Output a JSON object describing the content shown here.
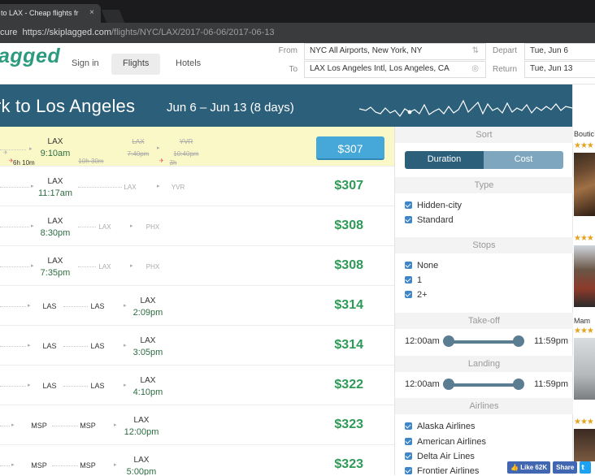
{
  "browser": {
    "tab_title": "to LAX - Cheap flights fr",
    "tab_close": "×",
    "url_prefix": "cure",
    "url_host": "https://skiplagged.com",
    "url_path": "/flights/NYC/LAX/2017-06-06/2017-06-13"
  },
  "header": {
    "logo": "agged",
    "nav": [
      "Sign in",
      "Flights",
      "Hotels"
    ],
    "from_label": "From",
    "to_label": "To",
    "from_value": "NYC  All Airports, New York, NY",
    "to_value": "LAX  Los Angeles Intl, Los Angeles, CA",
    "depart_label": "Depart",
    "return_label": "Return",
    "depart_value": "Tue, Jun 6",
    "return_value": "Tue, Jun 13"
  },
  "banner": {
    "title": "rk to Los Angeles",
    "dates": "Jun 6 – Jun 13 (8 days)"
  },
  "results": [
    {
      "highlight": true,
      "price": "$307",
      "dest_code": "LAX",
      "arrive": "9:10am",
      "duration": "6h 10m",
      "alt_a": "LAX",
      "alt_a_time": "7:40pm",
      "alt_b": "YVR",
      "alt_b_time": "10:40pm",
      "alt_dur": "10h 30m",
      "alt_dur2": "3h"
    },
    {
      "price": "$307",
      "dest_code": "LAX",
      "arrive": "11:17am",
      "stop1": "LAX",
      "stop2": "YVR"
    },
    {
      "price": "$308",
      "dest_code": "LAX",
      "arrive": "8:30pm",
      "stop1": "LAX",
      "stop2": "PHX"
    },
    {
      "price": "$308",
      "dest_code": "LAX",
      "arrive": "7:35pm",
      "stop1": "LAX",
      "stop2": "PHX"
    },
    {
      "price": "$314",
      "stop1": "LAS",
      "stop2": "LAS",
      "dest_code": "LAX",
      "arrive": "2:09pm"
    },
    {
      "price": "$314",
      "stop1": "LAS",
      "stop2": "LAS",
      "dest_code": "LAX",
      "arrive": "3:05pm"
    },
    {
      "price": "$322",
      "stop1": "LAS",
      "stop2": "LAS",
      "dest_code": "LAX",
      "arrive": "4:10pm"
    },
    {
      "price": "$323",
      "stop1": "MSP",
      "stop2": "MSP",
      "dest_code": "LAX",
      "arrive": "12:00pm"
    },
    {
      "price": "$323",
      "stop1": "MSP",
      "stop2": "MSP",
      "dest_code": "LAX",
      "arrive": "5:00pm"
    }
  ],
  "filters": {
    "sort_header": "Sort",
    "sort_options": [
      "Duration",
      "Cost"
    ],
    "sort_selected": "Duration",
    "type_header": "Type",
    "type_options": [
      "Hidden-city",
      "Standard"
    ],
    "stops_header": "Stops",
    "stops_options": [
      "None",
      "1",
      "2+"
    ],
    "takeoff_header": "Take-off",
    "takeoff_min": "12:00am",
    "takeoff_max": "11:59pm",
    "landing_header": "Landing",
    "landing_min": "12:00am",
    "landing_max": "11:59pm",
    "airlines_header": "Airlines",
    "airlines": [
      "Alaska Airlines",
      "American Airlines",
      "Delta Air Lines",
      "Frontier Airlines"
    ]
  },
  "hotels": {
    "names": [
      "Boutic",
      "Mam"
    ],
    "stars": "★★★"
  },
  "social": {
    "like": "Like 62K",
    "share": "Share"
  },
  "colors": {
    "brand_green": "#2b9a7f",
    "banner": "#2c5f7a",
    "price_green": "#2e9a57",
    "button_blue": "#46a8d8",
    "highlight_row": "#fbf8c8"
  }
}
